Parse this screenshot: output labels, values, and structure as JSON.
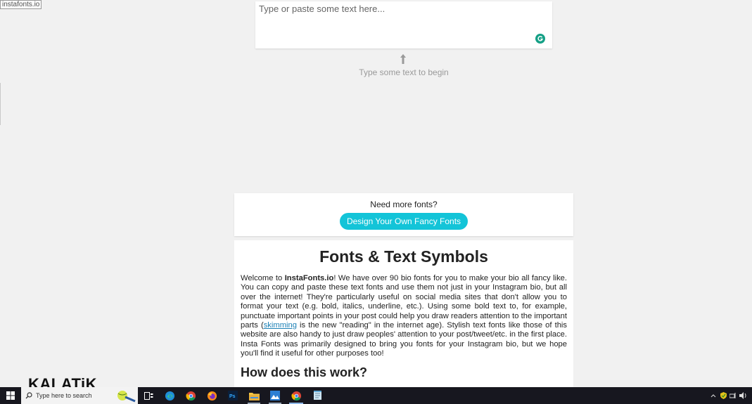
{
  "site_badge": "instafonts.io",
  "input": {
    "placeholder": "Type or paste some text here..."
  },
  "hint": "Type some text to begin",
  "promo": {
    "question": "Need more fonts?",
    "button_label": "Design Your Own Fancy Fonts"
  },
  "article": {
    "title": "Fonts & Text Symbols",
    "intro_start": "Welcome to ",
    "intro_brand": "InstaFonts.io",
    "intro_mid": "! We have over 90 bio fonts for you to make your bio all fancy like. You can copy and paste these text fonts and use them not just in your Instagram bio, but all over the internet! They're particularly useful on social media sites that don't allow you to format your text (e.g. bold, italics, underline, etc.). Using some bold text to, for example, punctuate important points in your post could help you draw readers attention to the important parts (",
    "intro_link": "skimming",
    "intro_end": " is the new \"reading\" in the internet age). Stylish text fonts like those of this website are also handy to just draw peoples' attention to your post/tweet/etc. in the first place. Insta Fonts was primarily designed to bring you fonts for your Instagram bio, but we hope you'll find it useful for other purposes too!",
    "subheading": "How does this work?"
  },
  "watermark": "KALATiK",
  "taskbar": {
    "search_placeholder": "Type here to search",
    "apps": [
      "task-view",
      "edge",
      "chrome",
      "firefox",
      "photoshop",
      "file-explorer",
      "photos",
      "chrome-active",
      "notepad"
    ],
    "icons": {
      "start": "windows-icon",
      "search": "magnifier-icon"
    },
    "accent": "#0f77d4"
  },
  "colors": {
    "button": "#13c4d8",
    "link": "#1a7fb5",
    "grammarly": "#15a086"
  }
}
